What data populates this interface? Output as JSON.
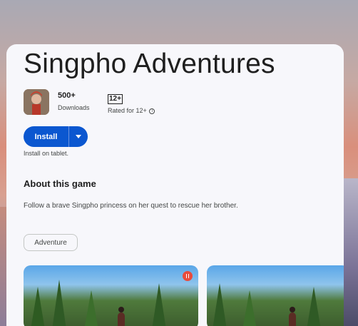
{
  "app": {
    "title": "Singpho Adventures",
    "downloads_value": "500+",
    "downloads_label": "Downloads",
    "rating_badge": "12+",
    "rating_label": "Rated for 12+"
  },
  "install": {
    "label": "Install",
    "note": "Install on tablet."
  },
  "about": {
    "heading": "About this game",
    "description": "Follow a brave Singpho princess on her quest to rescue her brother."
  },
  "tags": [
    "Adventure"
  ],
  "colors": {
    "accent": "#0b57d0",
    "card_bg": "#f7f7fb",
    "text_primary": "#1f1f1f",
    "text_secondary": "#444746",
    "badge_red": "#e94b3c"
  },
  "icons": {
    "caret": "chevron-down-icon",
    "info": "info-icon",
    "pause": "pause-icon"
  }
}
